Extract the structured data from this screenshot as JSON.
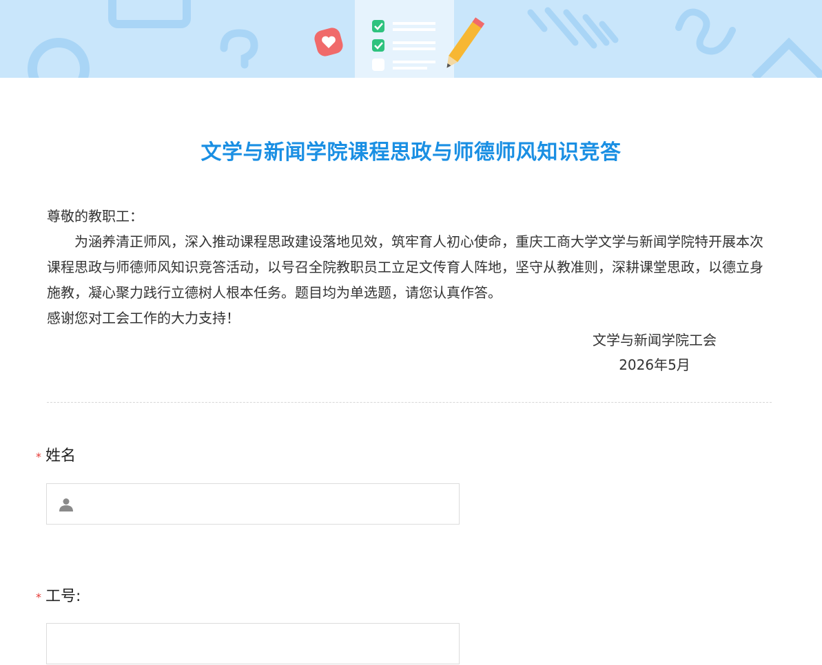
{
  "banner": {
    "colors": {
      "background": "#c9e6fb",
      "shapes": "#a9d5f6",
      "card": "#e6f3fd",
      "check": "#2ec27e",
      "pencil": "#f7b733",
      "heart": "#f06a6a"
    }
  },
  "title": "文学与新闻学院课程思政与师德师风知识竞答",
  "intro": {
    "greeting": "尊敬的教职工：",
    "body": "为涵养清正师风，深入推动课程思政建设落地见效，筑牢育人初心使命，重庆工商大学文学与新闻学院特开展本次课程思政与师德师风知识竞答活动，以号召全院教职员工立足文传育人阵地，坚守从教准则，深耕课堂思政，以德立身施教，凝心聚力践行立德树人根本任务。题目均为单选题，请您认真作答。",
    "thanks": "感谢您对工会工作的大力支持！",
    "signature": "文学与新闻学院工会",
    "date": "2026年5月"
  },
  "questions": [
    {
      "required_mark": "*",
      "label": "姓名",
      "value": "",
      "icon": "user-icon"
    },
    {
      "required_mark": "*",
      "label": "工号:",
      "value": ""
    }
  ]
}
